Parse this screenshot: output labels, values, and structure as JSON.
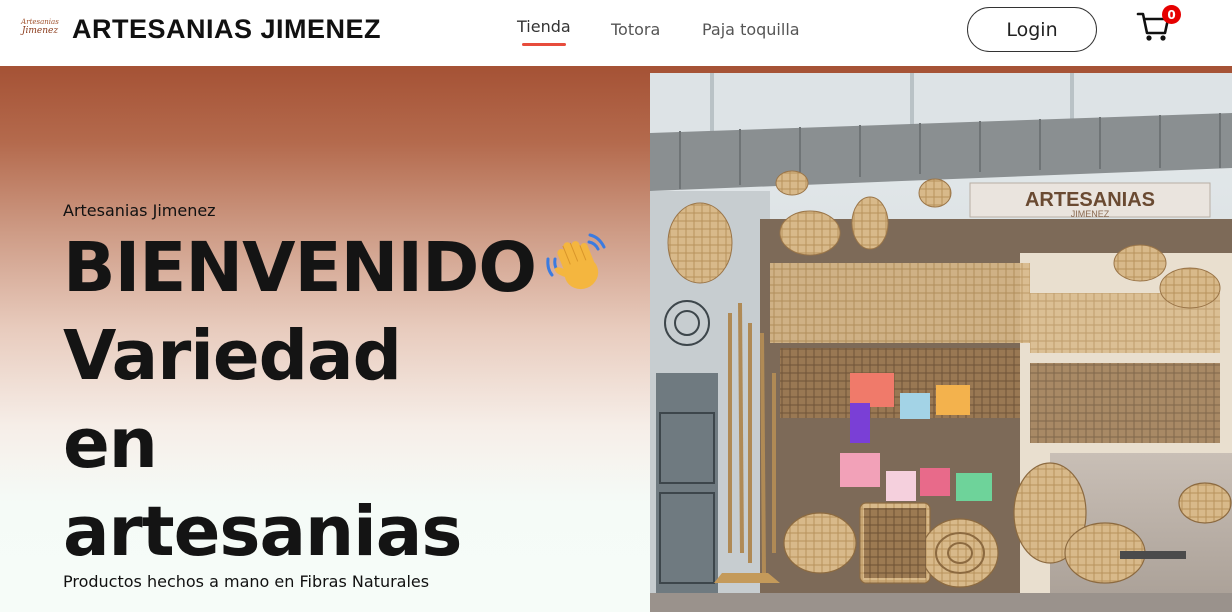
{
  "header": {
    "logo_line1": "Artesanias",
    "logo_line2": "Jimenez",
    "brand": "ARTESANIAS JIMENEZ",
    "nav": [
      {
        "label": "Tienda",
        "active": true
      },
      {
        "label": "Totora",
        "active": false
      },
      {
        "label": "Paja toquilla",
        "active": false
      }
    ],
    "login_label": "Login",
    "cart_icon": "shopping-cart-icon",
    "cart_count": "0"
  },
  "hero": {
    "eyebrow": "Artesanias Jimenez",
    "headline": [
      "BIENVENIDO",
      "Variedad",
      "en",
      "artesanias"
    ],
    "wave_icon": "waving-hand-icon",
    "subtitle": "Productos hechos a mano en Fibras Naturales",
    "store_sign": "ARTESANIAS",
    "store_sign_sub": "JIMENEZ"
  },
  "colors": {
    "accent": "#e74c3c",
    "hero_top": "#a55235",
    "hero_bottom": "#f6fcf8",
    "badge": "#e60000"
  }
}
